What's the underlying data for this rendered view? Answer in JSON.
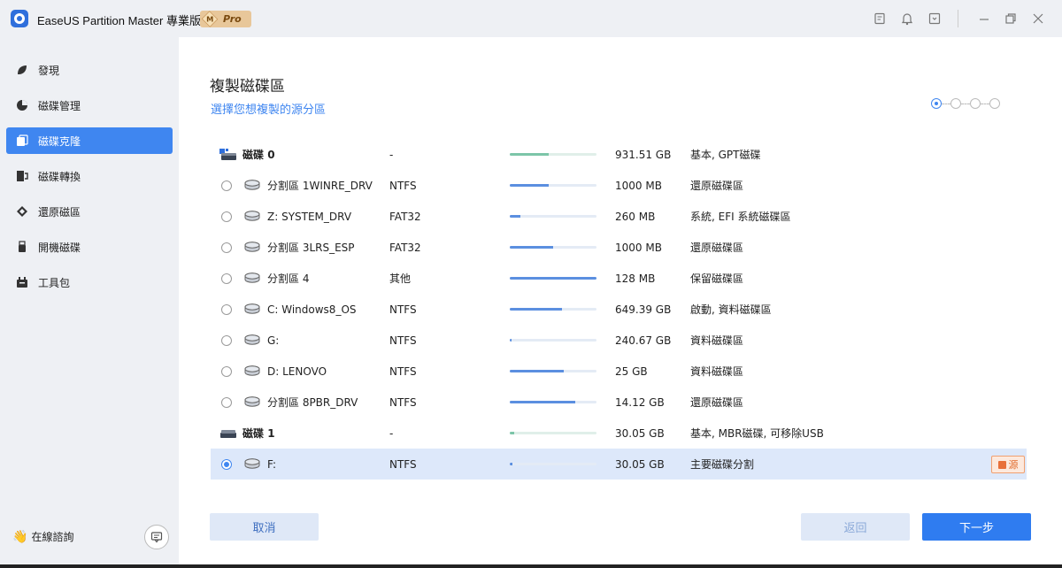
{
  "titlebar": {
    "app_title": "EaseUS Partition Master 專業版",
    "badge_m": "M",
    "badge_label": "Pro",
    "icons": [
      "notes-icon",
      "bell-icon",
      "dropdown-box-icon",
      "minimize-icon",
      "restore-icon",
      "close-icon"
    ]
  },
  "sidebar": {
    "items": [
      {
        "label": "發現",
        "icon": "leaf-icon"
      },
      {
        "label": "磁碟管理",
        "icon": "pie-icon"
      },
      {
        "label": "磁碟克隆",
        "icon": "clone-icon"
      },
      {
        "label": "磁碟轉換",
        "icon": "convert-icon"
      },
      {
        "label": "還原磁區",
        "icon": "recover-icon"
      },
      {
        "label": "開機磁碟",
        "icon": "usb-icon"
      },
      {
        "label": "工具包",
        "icon": "toolkit-icon"
      }
    ],
    "active_index": 2,
    "online_help": "在線諮詢"
  },
  "main": {
    "title": "複製磁碟區",
    "subtitle": "選擇您想複製的源分區",
    "steps_total": 4,
    "steps_current": 1,
    "rows": [
      {
        "kind": "disk",
        "label": "磁碟",
        "num": "0",
        "fs": "-",
        "usage": 0.45,
        "size": "931.51 GB",
        "type": "基本, GPT磁碟",
        "disk_style": "gpt"
      },
      {
        "kind": "part",
        "label": "分割區 1WINRE_DRV",
        "fs": "NTFS",
        "usage": 0.45,
        "size": "1000 MB",
        "type": "還原磁碟區"
      },
      {
        "kind": "part",
        "label": "Z: SYSTEM_DRV",
        "fs": "FAT32",
        "usage": 0.12,
        "size": "260 MB",
        "type": "系統, EFI 系統磁碟區"
      },
      {
        "kind": "part",
        "label": "分割區 3LRS_ESP",
        "fs": "FAT32",
        "usage": 0.5,
        "size": "1000 MB",
        "type": "還原磁碟區"
      },
      {
        "kind": "part",
        "label": "分割區 4",
        "fs": "其他",
        "usage": 1.0,
        "size": "128 MB",
        "type": "保留磁碟區"
      },
      {
        "kind": "part",
        "label": "C: Windows8_OS",
        "fs": "NTFS",
        "usage": 0.6,
        "size": "649.39 GB",
        "type": "啟動, 資料磁碟區"
      },
      {
        "kind": "part",
        "label": "G:",
        "fs": "NTFS",
        "usage": 0.02,
        "size": "240.67 GB",
        "type": "資料磁碟區"
      },
      {
        "kind": "part",
        "label": "D: LENOVO",
        "fs": "NTFS",
        "usage": 0.62,
        "size": "25 GB",
        "type": "資料磁碟區"
      },
      {
        "kind": "part",
        "label": "分割區 8PBR_DRV",
        "fs": "NTFS",
        "usage": 0.75,
        "size": "14.12 GB",
        "type": "還原磁碟區"
      },
      {
        "kind": "disk",
        "label": "磁碟",
        "num": "1",
        "fs": "-",
        "usage": 0.05,
        "size": "30.05 GB",
        "type": "基本, MBR磁碟, 可移除USB",
        "disk_style": "usb"
      },
      {
        "kind": "part",
        "label": "F:",
        "fs": "NTFS",
        "usage": 0.03,
        "size": "30.05 GB",
        "type": "主要磁碟分割",
        "selected": true,
        "badge": "源"
      }
    ],
    "cancel_label": "取消",
    "back_label": "返回",
    "next_label": "下一步"
  },
  "colors": {
    "accent": "#3f86f0",
    "next_button": "#2f7cf0",
    "selected_row": "#dde8fa",
    "badge_orange": "#e8703a"
  }
}
